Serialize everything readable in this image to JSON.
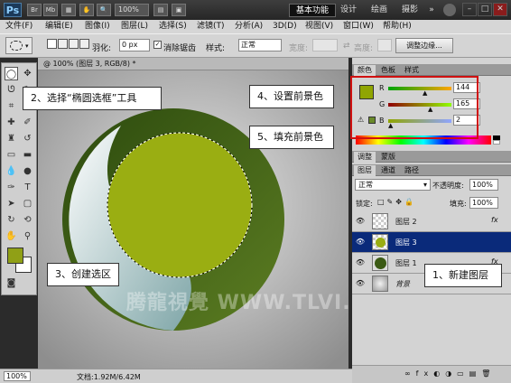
{
  "titlebar": {
    "logo": "Ps",
    "buttons": [
      "Br",
      "Mb"
    ],
    "zoom": "100%",
    "workspaces": [
      "基本功能",
      "设计",
      "绘画",
      "摄影"
    ],
    "more": "»"
  },
  "menubar": {
    "items": [
      "文件(F)",
      "编辑(E)",
      "图像(I)",
      "图层(L)",
      "选择(S)",
      "滤镜(T)",
      "分析(A)",
      "3D(D)",
      "视图(V)",
      "窗口(W)",
      "帮助(H)"
    ]
  },
  "options": {
    "feather_label": "羽化:",
    "feather_value": "0 px",
    "antialias_label": "消除锯齿",
    "antialias_checked": "✓",
    "style_label": "样式:",
    "style_value": "正常",
    "width_label": "宽度:",
    "height_label": "高度:",
    "refine_edge": "调整边缘..."
  },
  "document": {
    "tab_title": "@ 100% (图层 3, RGB/8) *"
  },
  "status": {
    "zoom": "100%",
    "doc_info": "文档:1.92M/6.42M"
  },
  "color_panel": {
    "tabs": [
      "颜色",
      "色板",
      "样式"
    ],
    "r_label": "R",
    "g_label": "G",
    "b_label": "B",
    "r_value": "144",
    "g_value": "165",
    "b_value": "2",
    "foreground_color": "#90a502"
  },
  "adjust_panel": {
    "tabs": [
      "调整",
      "蒙版"
    ]
  },
  "layers_panel": {
    "tabs": [
      "图层",
      "通道",
      "路径"
    ],
    "blend_mode": "正常",
    "opacity_label": "不透明度:",
    "opacity_value": "100%",
    "lock_label": "锁定:",
    "fill_label": "填充:",
    "fill_value": "100%",
    "layers": [
      {
        "name": "图层 2",
        "fx": "fx",
        "selected": false
      },
      {
        "name": "图层 3",
        "fx": "",
        "selected": true
      },
      {
        "name": "图层 1",
        "fx": "fx",
        "selected": false
      },
      {
        "name": "背景",
        "fx": "",
        "selected": false
      }
    ]
  },
  "callouts": {
    "c1": "1、新建图层",
    "c2": "2、选择“椭圆选框”工具",
    "c3": "3、创建选区",
    "c4": "4、设置前景色",
    "c5": "5、填充前景色"
  },
  "watermark": "腾龍視覺 WWW.TLVI.NET",
  "colors": {
    "dark_green": "#3b5a14",
    "lime": "#9aae12",
    "highlight_red": "#d01010",
    "selection_blue": "#0a2a7a"
  }
}
